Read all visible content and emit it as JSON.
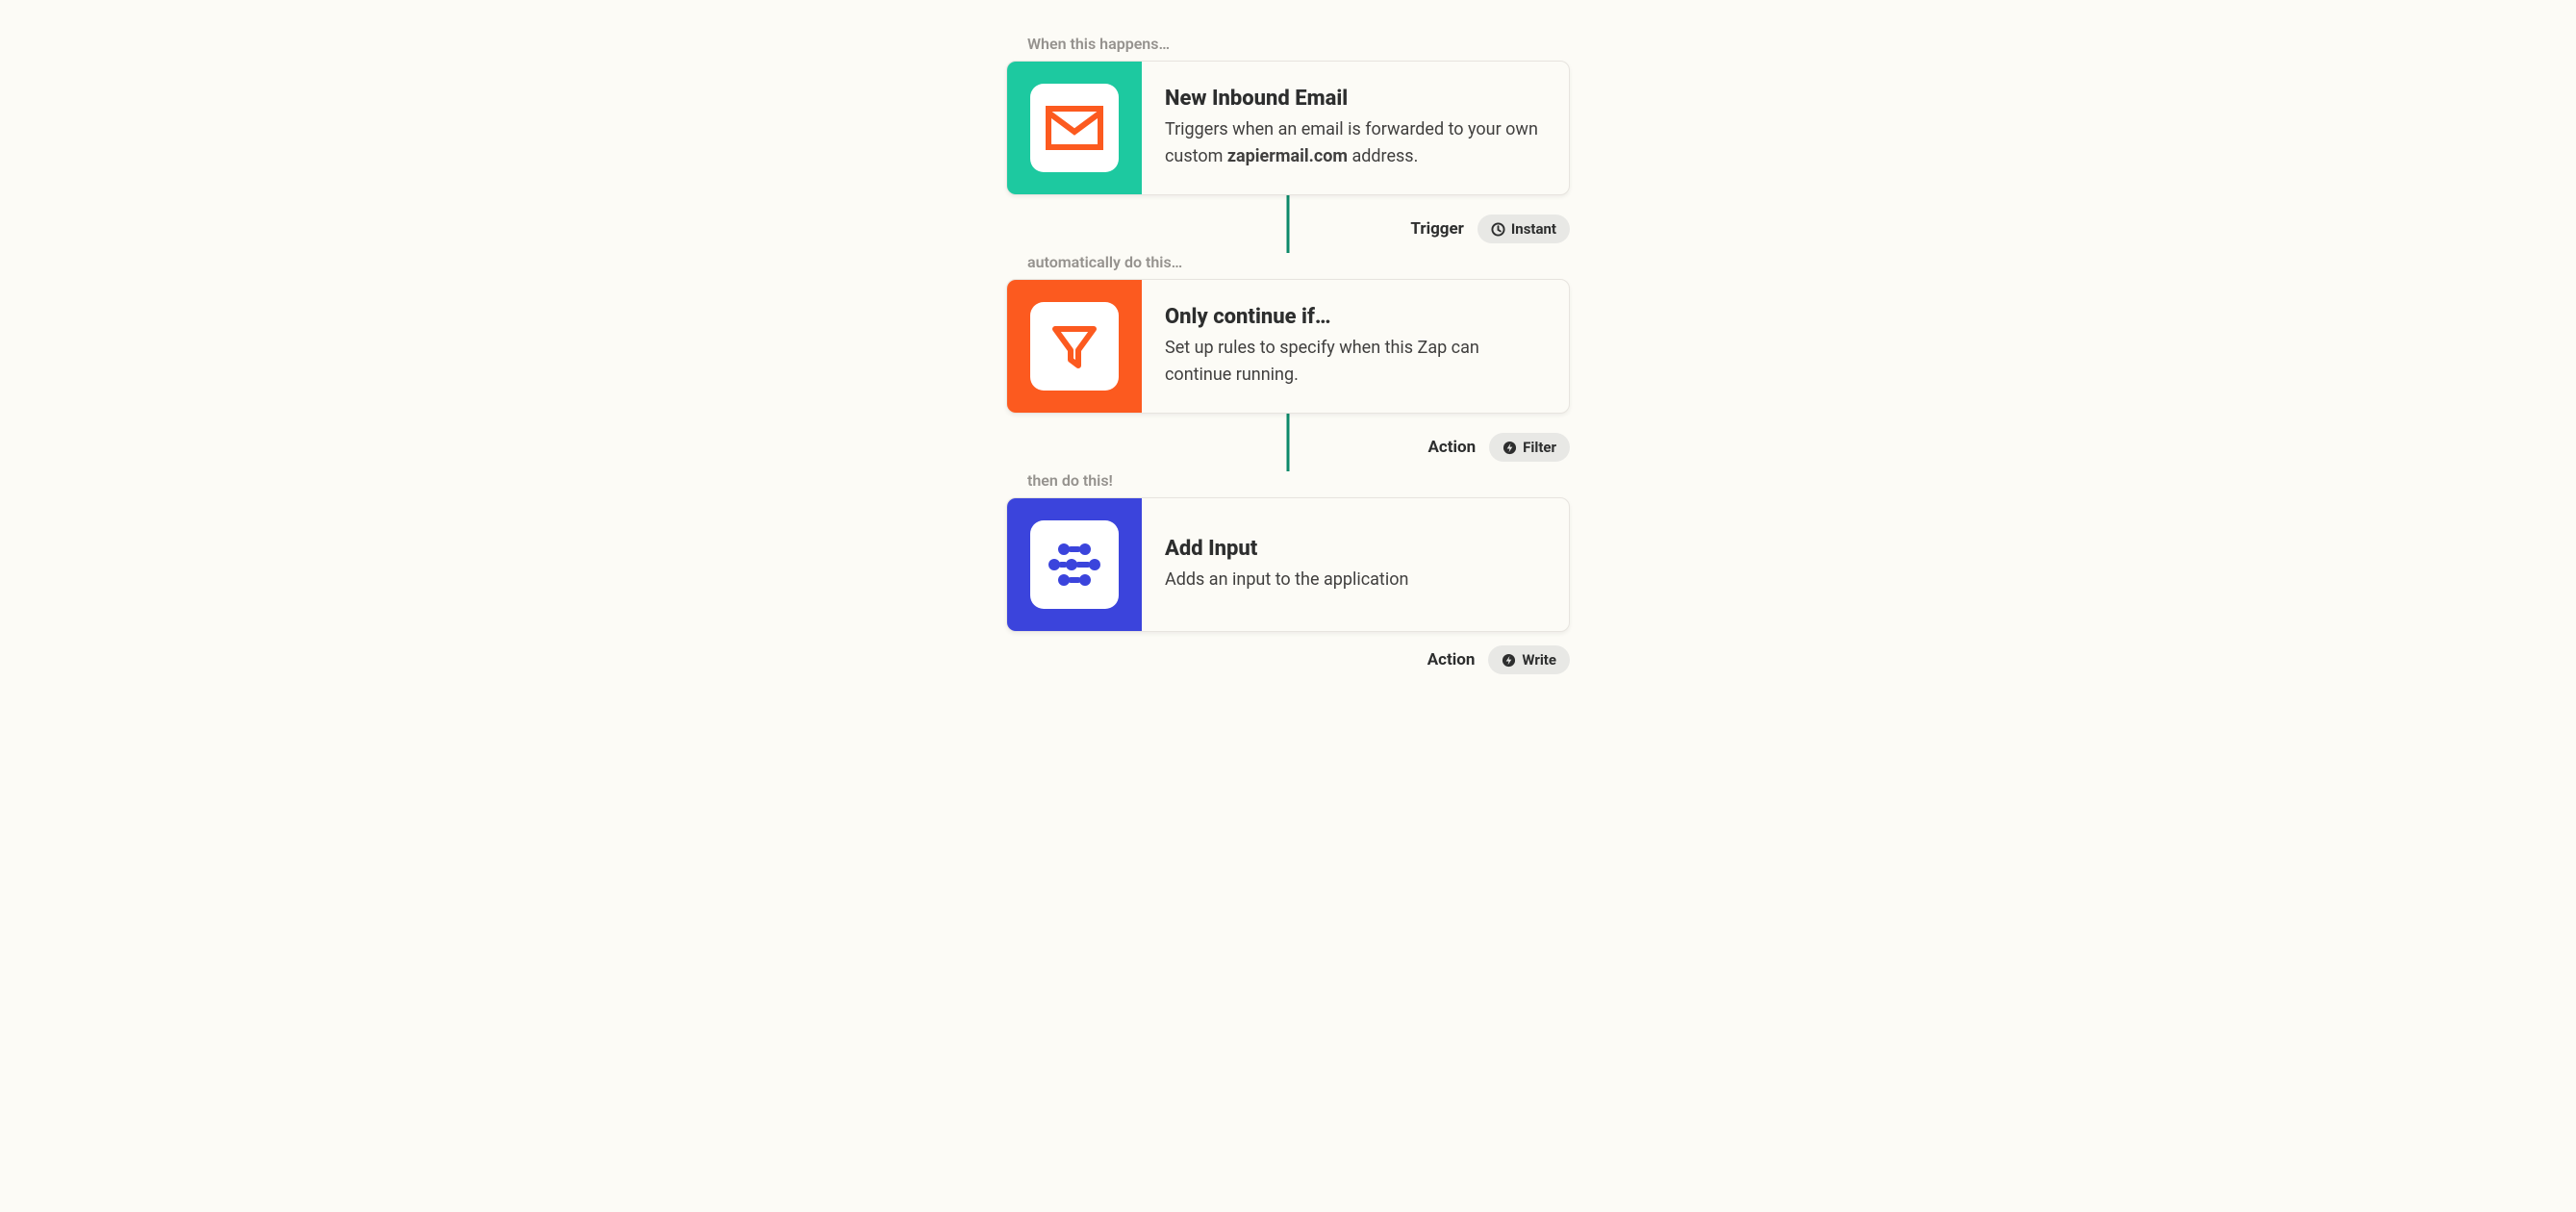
{
  "steps": [
    {
      "section_label": "When this happens…",
      "title": "New Inbound Email",
      "desc_pre": "Triggers when an email is forwarded to your own custom ",
      "desc_bold": "zapiermail.com",
      "desc_post": " address.",
      "meta_label": "Trigger",
      "badge_text": "Instant",
      "badge_icon": "clock",
      "accent": "teal",
      "icon": "envelope"
    },
    {
      "section_label": "automatically do this…",
      "title": "Only continue if…",
      "desc_pre": "Set up rules to specify when this Zap can continue running.",
      "desc_bold": "",
      "desc_post": "",
      "meta_label": "Action",
      "badge_text": "Filter",
      "badge_icon": "bolt",
      "accent": "orange",
      "icon": "funnel"
    },
    {
      "section_label": "then do this!",
      "title": "Add Input",
      "desc_pre": "Adds an input to the application",
      "desc_bold": "",
      "desc_post": "",
      "meta_label": "Action",
      "badge_text": "Write",
      "badge_icon": "bolt",
      "accent": "blue",
      "icon": "nodes"
    }
  ]
}
